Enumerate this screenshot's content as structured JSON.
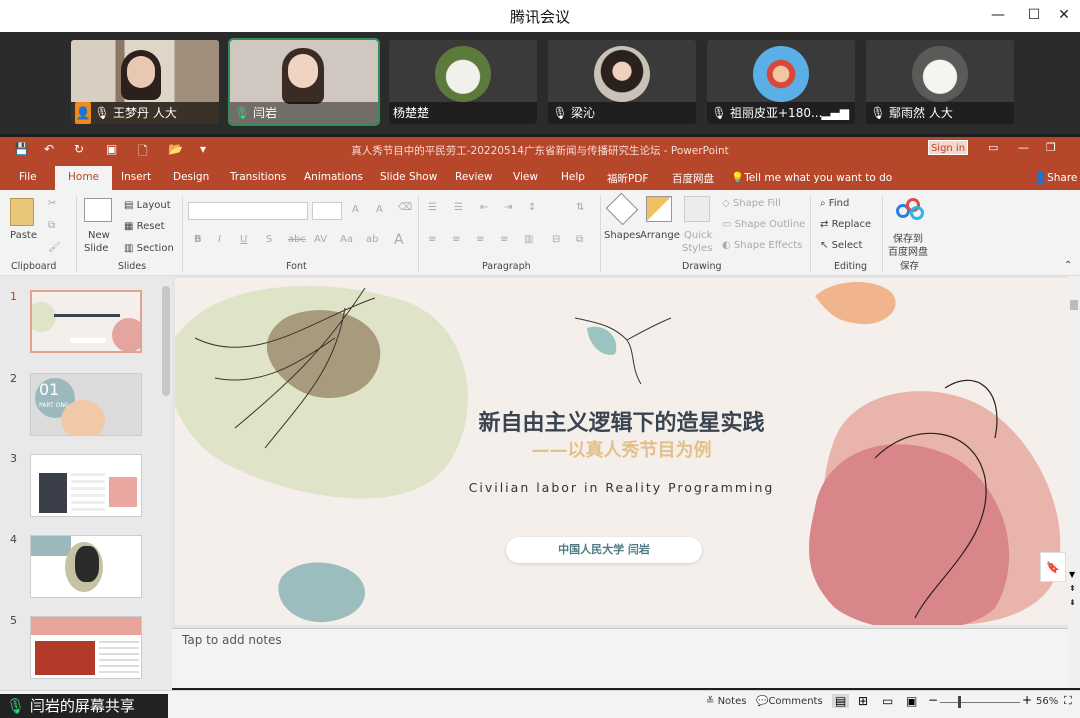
{
  "window": {
    "title": "腾讯会议"
  },
  "participants": [
    {
      "name": "王梦丹 人大",
      "mic": "muted",
      "badge": "host"
    },
    {
      "name": "闫岩",
      "mic": "on",
      "active": true
    },
    {
      "name": "杨楚楚",
      "mic": "none"
    },
    {
      "name": "梁沁",
      "mic": "muted"
    },
    {
      "name": "祖丽皮亚+180...",
      "mic": "muted",
      "signal": true
    },
    {
      "name": "鄢雨然 人大",
      "mic": "muted"
    }
  ],
  "ppt": {
    "doc_title": "真人秀节目中的平民劳工-20220514广东省新闻与传播研究生论坛  -  PowerPoint",
    "sign_in": "Sign in",
    "share": "Share",
    "tabs": [
      "File",
      "Home",
      "Insert",
      "Design",
      "Transitions",
      "Animations",
      "Slide Show",
      "Review",
      "View",
      "Help",
      "福昕PDF",
      "百度网盘"
    ],
    "tell_me": "Tell me what you want to do",
    "ribbon": {
      "paste": "Paste",
      "clipboard": "Clipboard",
      "new_slide_1": "New",
      "new_slide_2": "Slide",
      "layout": "Layout",
      "reset": "Reset",
      "section": "Section",
      "slides": "Slides",
      "font": "Font",
      "paragraph": "Paragraph",
      "shapes": "Shapes",
      "arrange": "Arrange",
      "quick_1": "Quick",
      "quick_2": "Styles",
      "shape_fill": "Shape Fill",
      "shape_outline": "Shape Outline",
      "shape_effects": "Shape Effects",
      "drawing": "Drawing",
      "find": "Find",
      "replace": "Replace",
      "select": "Select",
      "editing": "Editing",
      "save_1": "保存到",
      "save_2": "百度网盘",
      "save_group": "保存"
    },
    "slide_numbers": [
      "1",
      "2",
      "3",
      "4",
      "5"
    ],
    "thumb2_text": "01",
    "thumb2_sub": "PART ONE",
    "slide": {
      "title": "新自由主义逻辑下的造星实践",
      "subtitle": "——以真人秀节目为例",
      "english": "Civilian labor in Reality Programming",
      "author": "中国人民大学 闫岩"
    },
    "notes_placeholder": "Tap to add notes",
    "status": {
      "notes": "Notes",
      "comments": "Comments",
      "zoom": "56%"
    }
  },
  "screen_share_label": "闫岩的屏幕共享",
  "colors": {
    "ppt_accent": "#b7472a",
    "slide_bg": "#f5efeb",
    "subtitle": "#e3c08a",
    "title": "#3a4450"
  }
}
